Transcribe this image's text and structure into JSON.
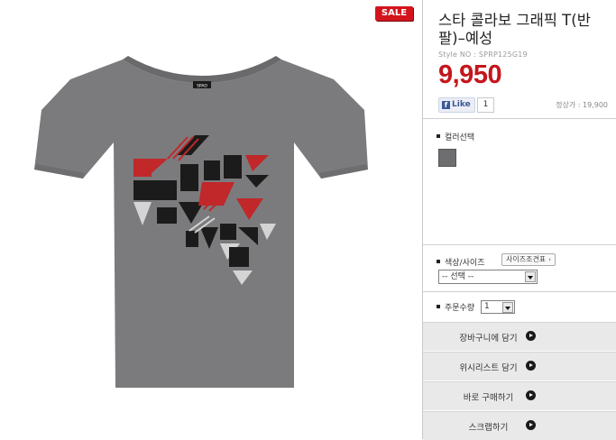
{
  "badge": {
    "sale": "SALE"
  },
  "product": {
    "title": "스타 콜라보 그래픽 T(반팔)–예성",
    "style_no": "Style NO : SPRP125G19",
    "price": "9,950",
    "list_price": "정상가 : 19,900",
    "neck_label": "SPAO"
  },
  "social": {
    "like_label": "Like",
    "like_count": "1"
  },
  "color": {
    "label": "컬러선택",
    "swatch_color": "#6e6e70"
  },
  "size": {
    "label": "색상/사이즈",
    "guide_button": "사이즈조견표",
    "select_value": "-- 선택 --"
  },
  "quantity": {
    "label": "주문수량",
    "value": "1"
  },
  "actions": [
    {
      "label": "장바구니에 담기"
    },
    {
      "label": "위시리스트 담기"
    },
    {
      "label": "바로 구매하기"
    },
    {
      "label": "스크랩하기"
    }
  ],
  "colors": {
    "price_red": "#c4161c",
    "sale_red": "#d3141d",
    "shirt_gray": "#7b7b7d"
  }
}
